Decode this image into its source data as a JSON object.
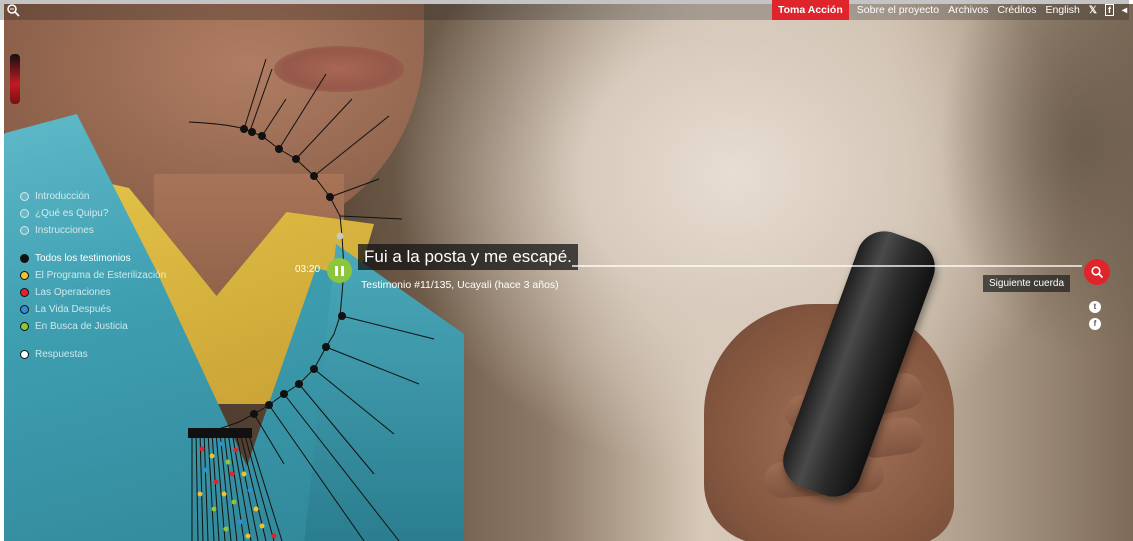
{
  "topbar": {
    "logo_icon": "quipu-logo-icon",
    "nav": {
      "cta_label": "Toma Acción",
      "items": [
        "Sobre el proyecto",
        "Archivos",
        "Créditos",
        "English"
      ],
      "social_icons": [
        "twitter-icon",
        "facebook-icon",
        "share-icon"
      ]
    }
  },
  "menu": {
    "intro_items": [
      "Introducción",
      "¿Qué es Quipu?",
      "Instrucciones"
    ],
    "all_label": "Todos los testimonios",
    "categories": [
      {
        "label": "El Programa de Esterilización",
        "color": "#f2c12e"
      },
      {
        "label": "Las Operaciones",
        "color": "#e0242b"
      },
      {
        "label": "La Vida Después",
        "color": "#2f8ed8"
      },
      {
        "label": "En Busca de Justicia",
        "color": "#8cc63f"
      }
    ],
    "responses_label": "Respuestas"
  },
  "player": {
    "time": "03:20",
    "quote": "Fui a la posta y me escapé.",
    "meta": "Testimonio #11/135, Ucayali (hace 3 años)",
    "next_label": "Siguiente cuerda",
    "play_color": "#8cc63f",
    "accent": "#e0242b"
  },
  "share": {
    "icons": [
      "twitter-icon",
      "facebook-icon"
    ]
  }
}
